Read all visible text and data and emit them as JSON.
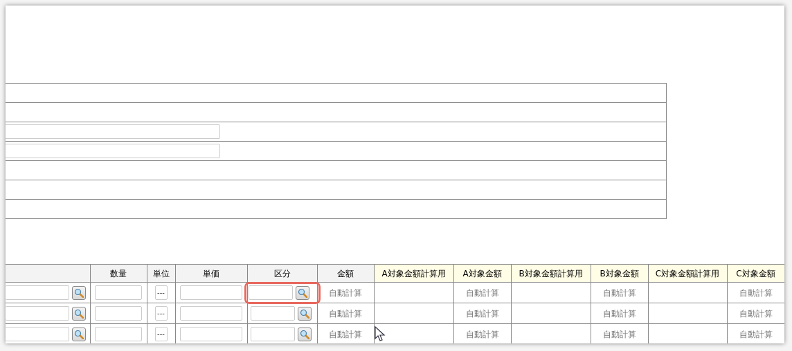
{
  "form_rows": [
    {
      "kind": "blank"
    },
    {
      "kind": "blank"
    },
    {
      "kind": "input"
    },
    {
      "kind": "input"
    },
    {
      "kind": "blank"
    },
    {
      "kind": "blank"
    },
    {
      "kind": "blank"
    }
  ],
  "table": {
    "columns": [
      {
        "kind": "plain"
      },
      {
        "label": "数量",
        "kind": "plain"
      },
      {
        "label": "単位",
        "kind": "plain"
      },
      {
        "label": "単価",
        "kind": "plain"
      },
      {
        "label": "区分",
        "kind": "plain"
      },
      {
        "label": "金額",
        "kind": "plain"
      },
      {
        "label": "A対象金額計算用",
        "kind": "target"
      },
      {
        "label": "A対象金額",
        "kind": "target"
      },
      {
        "label": "B対象金額計算用",
        "kind": "target"
      },
      {
        "label": "B対象金額",
        "kind": "target"
      },
      {
        "label": "C対象金額計算用",
        "kind": "target"
      },
      {
        "label": "C対象金額",
        "kind": "target"
      }
    ],
    "rows": [
      {
        "cells": [
          {
            "kind": "lookup",
            "highlighted": false
          },
          {
            "kind": "input"
          },
          {
            "kind": "select",
            "value": "---"
          },
          {
            "kind": "input"
          },
          {
            "kind": "lookup",
            "highlighted": true
          },
          {
            "kind": "auto",
            "text": "自動計算"
          },
          {
            "kind": "empty"
          },
          {
            "kind": "auto",
            "text": "自動計算"
          },
          {
            "kind": "empty"
          },
          {
            "kind": "auto",
            "text": "自動計算"
          },
          {
            "kind": "empty"
          },
          {
            "kind": "auto",
            "text": "自動計算"
          }
        ]
      },
      {
        "cells": [
          {
            "kind": "lookup",
            "highlighted": false
          },
          {
            "kind": "input"
          },
          {
            "kind": "select",
            "value": "---"
          },
          {
            "kind": "input"
          },
          {
            "kind": "lookup",
            "highlighted": false
          },
          {
            "kind": "auto",
            "text": "自動計算"
          },
          {
            "kind": "empty"
          },
          {
            "kind": "auto",
            "text": "自動計算"
          },
          {
            "kind": "empty"
          },
          {
            "kind": "auto",
            "text": "自動計算"
          },
          {
            "kind": "empty"
          },
          {
            "kind": "auto",
            "text": "自動計算"
          }
        ]
      },
      {
        "cells": [
          {
            "kind": "lookup",
            "highlighted": false
          },
          {
            "kind": "input"
          },
          {
            "kind": "select",
            "value": "---"
          },
          {
            "kind": "input"
          },
          {
            "kind": "lookup",
            "highlighted": false
          },
          {
            "kind": "auto",
            "text": "自動計算"
          },
          {
            "kind": "empty"
          },
          {
            "kind": "auto",
            "text": "自動計算"
          },
          {
            "kind": "empty"
          },
          {
            "kind": "auto",
            "text": "自動計算"
          },
          {
            "kind": "empty"
          },
          {
            "kind": "auto",
            "text": "自動計算"
          }
        ]
      }
    ]
  }
}
